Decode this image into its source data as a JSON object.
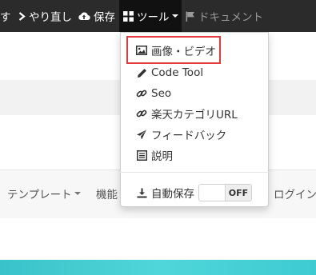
{
  "topbar": {
    "undo_fragment": "す",
    "redo_label": "やり直し",
    "save_label": "保存",
    "tools_label": "ツール",
    "document_label": "ドキュメント"
  },
  "tools_menu": {
    "items": [
      {
        "label": "画像・ビデオ",
        "icon": "image-icon"
      },
      {
        "label": "Code Tool",
        "icon": "pencil-icon"
      },
      {
        "label": "Seo",
        "icon": "link-icon"
      },
      {
        "label": "楽天カテゴリURL",
        "icon": "link-icon"
      },
      {
        "label": "フィードバック",
        "icon": "send-icon"
      },
      {
        "label": "説明",
        "icon": "list-icon"
      }
    ],
    "autosave_label": "自動保存",
    "autosave_state": "OFF"
  },
  "navbar": {
    "template_label": "テンプレート",
    "feature_label": "機能",
    "login_label": "ログイン"
  },
  "colors": {
    "topbar_bg": "#2b2b2b",
    "highlight": "#e33b3b",
    "teal": "#3ecbd2"
  }
}
